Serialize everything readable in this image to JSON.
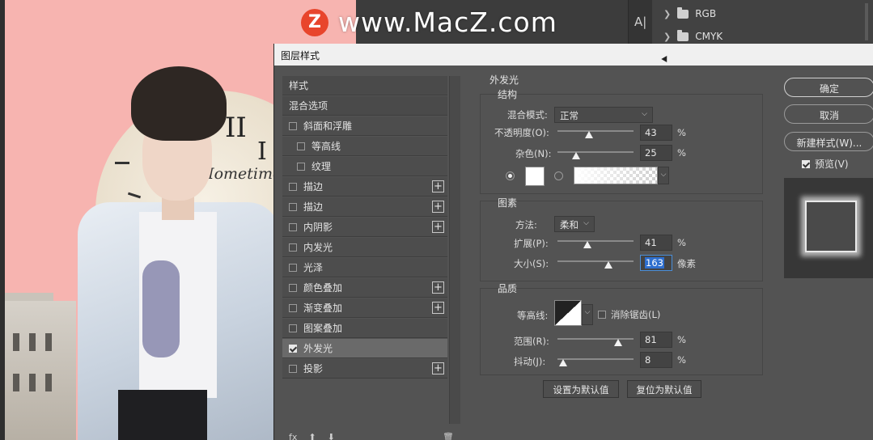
{
  "watermark": {
    "logo_letter": "Z",
    "text": "www.MacZ.com"
  },
  "canvas": {
    "clock_numeral_1": "II",
    "clock_numeral_2": "I",
    "clock_brand": "Hometime"
  },
  "toolbar": {
    "type_tool_label": "A|"
  },
  "channels": {
    "items": [
      {
        "label": "RGB"
      },
      {
        "label": "CMYK"
      }
    ]
  },
  "dialog": {
    "title": "图层样式",
    "styles_list": {
      "items": [
        {
          "label": "样式",
          "type": "header"
        },
        {
          "label": "混合选项",
          "type": "header"
        },
        {
          "label": "斜面和浮雕",
          "checked": false
        },
        {
          "label": "等高线",
          "checked": false,
          "indent": true
        },
        {
          "label": "纹理",
          "checked": false,
          "indent": true
        },
        {
          "label": "描边",
          "checked": false,
          "plus": true
        },
        {
          "label": "描边",
          "checked": false,
          "plus": true
        },
        {
          "label": "内阴影",
          "checked": false,
          "plus": true
        },
        {
          "label": "内发光",
          "checked": false
        },
        {
          "label": "光泽",
          "checked": false
        },
        {
          "label": "颜色叠加",
          "checked": false,
          "plus": true
        },
        {
          "label": "渐变叠加",
          "checked": false,
          "plus": true
        },
        {
          "label": "图案叠加",
          "checked": false
        },
        {
          "label": "外发光",
          "checked": true,
          "active": true
        },
        {
          "label": "投影",
          "checked": false,
          "plus": true
        }
      ],
      "footer_fx": "fx"
    },
    "outer_glow": {
      "title": "外发光",
      "structure": {
        "title": "结构",
        "blend_mode_label": "混合模式:",
        "blend_mode_value": "正常",
        "opacity_label": "不透明度(O):",
        "opacity_value": "43",
        "opacity_unit": "%",
        "noise_label": "杂色(N):",
        "noise_value": "25",
        "noise_unit": "%",
        "glow_color": "#ffffff"
      },
      "elements": {
        "title": "图素",
        "technique_label": "方法:",
        "technique_value": "柔和",
        "spread_label": "扩展(P):",
        "spread_value": "41",
        "spread_unit": "%",
        "size_label": "大小(S):",
        "size_value": "163",
        "size_unit": "像素"
      },
      "quality": {
        "title": "品质",
        "contour_label": "等高线:",
        "antialias_label": "消除锯齿(L)",
        "antialias_checked": false,
        "range_label": "范围(R):",
        "range_value": "81",
        "range_unit": "%",
        "jitter_label": "抖动(J):",
        "jitter_value": "8",
        "jitter_unit": "%"
      },
      "set_default_label": "设置为默认值",
      "reset_default_label": "复位为默认值"
    },
    "buttons": {
      "ok": "确定",
      "cancel": "取消",
      "new_style": "新建样式(W)...",
      "preview_label": "预览(V)",
      "preview_checked": true
    }
  }
}
